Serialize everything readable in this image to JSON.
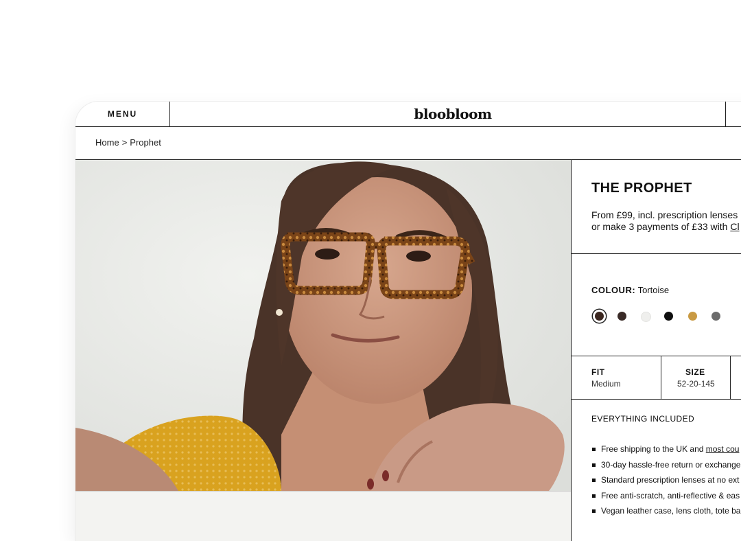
{
  "header": {
    "menu_label": "MENU",
    "logo": "bloobloom"
  },
  "breadcrumb": {
    "home": "Home",
    "separator": ">",
    "current": "Prophet"
  },
  "product": {
    "title": "THE PROPHET",
    "price_line": "From £99, incl. prescription lenses",
    "payment_prefix": "or make 3 payments of £33 with ",
    "payment_link": "Cl",
    "colour_label": "COLOUR:",
    "colour_value": "Tortoise",
    "swatches": [
      {
        "name": "tortoise",
        "color": "#3b2720",
        "selected": true
      },
      {
        "name": "dark-brown",
        "color": "#3a2b27",
        "selected": false
      },
      {
        "name": "clear",
        "color": "#efefed",
        "selected": false
      },
      {
        "name": "black",
        "color": "#0f0f0f",
        "selected": false
      },
      {
        "name": "honey",
        "color": "#c99a43",
        "selected": false
      },
      {
        "name": "grey",
        "color": "#6c6c6c",
        "selected": false
      }
    ],
    "fit_label": "FIT",
    "fit_value": "Medium",
    "size_label": "SIZE",
    "size_value": "52-20-145",
    "included_title": "EVERYTHING INCLUDED",
    "included": [
      {
        "text": "Free shipping to the UK and ",
        "link": "most cou"
      },
      {
        "text": "30-day hassle-free return or exchange",
        "link": ""
      },
      {
        "text": "Standard prescription lenses at no ext",
        "link": ""
      },
      {
        "text": "Free anti-scratch, anti-reflective & eas",
        "link": ""
      },
      {
        "text": "Vegan leather case, lens cloth, tote ba",
        "link": ""
      }
    ]
  },
  "colors": {
    "border": "#222222",
    "sweater": "#d9a21f",
    "frame": "#6b3f1c"
  }
}
